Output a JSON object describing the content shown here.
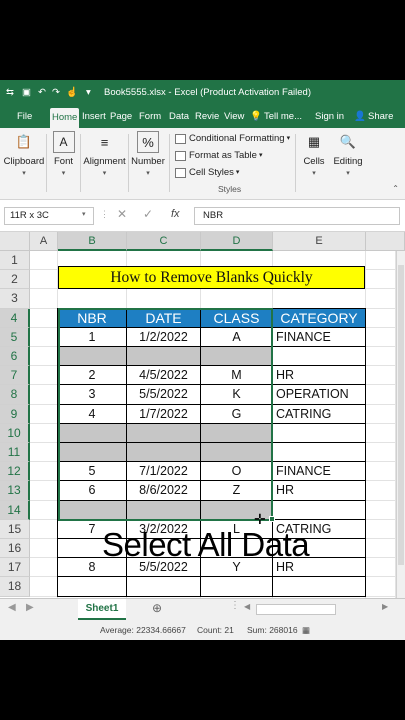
{
  "titlebar": {
    "app_icon": "excel-icon",
    "title": "Book5555.xlsx - Excel (Product Activation Failed)"
  },
  "tabs": [
    "File",
    "Home",
    "Insert",
    "Page",
    "Form",
    "Data",
    "Revie",
    "View",
    "Tell me...",
    "Sign in",
    "Share"
  ],
  "active_tab": "Home",
  "ribbon": {
    "clipboard": "Clipboard",
    "font": "Font",
    "alignment": "Alignment",
    "number": "Number",
    "conditional_formatting": "Conditional Formatting",
    "format_as_table": "Format as Table",
    "cell_styles": "Cell Styles",
    "styles": "Styles",
    "cells": "Cells",
    "editing": "Editing",
    "number_icon": "%"
  },
  "formula_bar": {
    "name_box": "11R x 3C",
    "fx": "fx",
    "content": "NBR"
  },
  "columns": [
    "A",
    "B",
    "C",
    "D",
    "E"
  ],
  "rows": [
    "1",
    "2",
    "3",
    "4",
    "5",
    "6",
    "7",
    "8",
    "9",
    "10",
    "11",
    "12",
    "13",
    "14",
    "15",
    "16",
    "17",
    "18"
  ],
  "sheet": {
    "title": "How to Remove Blanks Quickly",
    "headers": [
      "NBR",
      "DATE",
      "CLASS",
      "CATEGORY"
    ],
    "data": [
      [
        "1",
        "1/2/2022",
        "A",
        "FINANCE"
      ],
      [
        "",
        "",
        "",
        ""
      ],
      [
        "2",
        "4/5/2022",
        "M",
        "HR"
      ],
      [
        "3",
        "5/5/2022",
        "K",
        "OPERATION"
      ],
      [
        "4",
        "1/7/2022",
        "G",
        "CATRING"
      ],
      [
        "",
        "",
        "",
        ""
      ],
      [
        "",
        "",
        "",
        ""
      ],
      [
        "5",
        "7/1/2022",
        "O",
        "FINANCE"
      ],
      [
        "6",
        "8/6/2022",
        "Z",
        "HR"
      ],
      [
        "",
        "",
        "",
        ""
      ],
      [
        "7",
        "3/2/2022",
        "L",
        "CATRING"
      ],
      [
        "",
        "",
        "",
        ""
      ],
      [
        "8",
        "5/5/2022",
        "Y",
        "HR"
      ],
      [
        "",
        "",
        "",
        ""
      ]
    ]
  },
  "overlay_text": "Select All Data",
  "sheet_tab": "Sheet1",
  "status": {
    "average": "Average: 22334.66667",
    "count": "Count: 21",
    "sum": "Sum: 268016"
  },
  "colors": {
    "excel_green": "#217346",
    "header_blue": "#1e7fc3",
    "title_yellow": "#ffff00",
    "blank_gray": "#c6c6c6"
  }
}
